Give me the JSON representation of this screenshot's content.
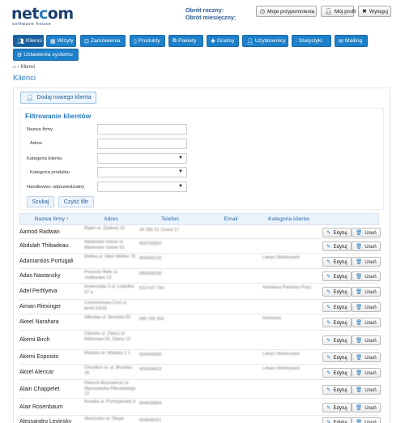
{
  "logo": {
    "main": "net⭕m",
    "main_text": "netcom",
    "tagline": "software house"
  },
  "stats": {
    "annual": "Obrót roczny:",
    "monthly": "Obrót miesięczny:"
  },
  "top_buttons": [
    {
      "label": "Moje przypomnienia",
      "icon": "clock-icon"
    },
    {
      "label": "Mój profil",
      "icon": "user-icon"
    },
    {
      "label": "Wyloguj",
      "icon": "close-icon"
    }
  ],
  "nav": [
    {
      "label": "Klienci",
      "icon": "users-icon"
    },
    {
      "label": "Wizyty",
      "icon": "grid-icon"
    },
    {
      "label": "Zamówienia",
      "icon": "cart-icon"
    },
    {
      "label": "Produkty",
      "icon": "file-icon"
    },
    {
      "label": "Pakiety",
      "icon": "copy-icon"
    },
    {
      "label": "Gratisy",
      "icon": "gift-icon"
    },
    {
      "label": "Użytkownicy",
      "icon": "user-icon"
    },
    {
      "label": "Statystyki",
      "icon": "chart-icon"
    },
    {
      "label": "Mailing",
      "icon": "mail-icon"
    },
    {
      "label": "Ustawienia systemu",
      "icon": "gear-icon"
    }
  ],
  "breadcrumb": {
    "home_icon": "home-icon",
    "separator": "›",
    "current": "Klienci"
  },
  "page_title": "Klienci",
  "add_button": "Dodaj nowego klienta",
  "filter": {
    "title": "Filtrowanie klientów",
    "labels": {
      "company": "Nazwa firmy",
      "address": "Adres",
      "client_category": "Kategoria klienta",
      "product_category": "Kategoria produktu",
      "sales_rep": "Handlowiec odpowiedzialny"
    },
    "search_button": "Szukaj",
    "clear_button": "Czyść filtr"
  },
  "table": {
    "headers": [
      "Nazwa firmy ↑",
      "Adres",
      "Telefon",
      "Email",
      "Kategoria klienta"
    ],
    "edit_label": "Edytuj",
    "delete_label": "Usuń",
    "rows": [
      {
        "name": "Aamod Radwan",
        "addr": "Rypin ul. Zjodnoś 22",
        "phone": "24 390 01 11sew 17",
        "cat": ""
      },
      {
        "name": "Abdulah Thibadeau",
        "addr": "Warlinskie Górne ul. Warlinskie Górne 51",
        "phone": "603755802",
        "cat": ""
      },
      {
        "name": "Adamantios Portugali",
        "addr": "Wołów ul. Wieś Wołów 78",
        "phone": "609556132",
        "cat": "Lekarz Weterynarii"
      },
      {
        "name": "Adas Nastansky",
        "addr": "Pożarów Mały ul. Jodłowska 13",
        "phone": "696506030",
        "cat": ""
      },
      {
        "name": "Adel Perfilyeva",
        "addr": "Inowrocław 3 ul. Łokietka 27 a",
        "phone": "523 547 750",
        "cat": "Hodowca Pokarmu Pasz"
      },
      {
        "name": "Aiman Riexinger",
        "addr": "Częstochowa Cem ul. Armii 54/18",
        "phone": "",
        "cat": ""
      },
      {
        "name": "Akeel Narahara",
        "addr": "Włocław ul. Brońska 82",
        "phone": "690 700 354",
        "cat": "Hodowca"
      },
      {
        "name": "Akemi Birch",
        "addr": "Żdanów ul. Żdany ul. Wiśniowa 20, Żdany 12",
        "phone": "",
        "cat": ""
      },
      {
        "name": "Akemi Esposito",
        "addr": "Kłodzko ul. Wiejska 1 1",
        "phone": "600465830",
        "cat": "Lekarz Weterynarii"
      },
      {
        "name": "Aksel Alencar",
        "addr": "Chrzelice ul. ul. Brzeska 78",
        "phone": "609504912",
        "cat": "Lekarz Weterynarii"
      },
      {
        "name": "Alain Chappelet",
        "addr": "Otwock Mazowiecki ul. Warszawska Piłsudskiego 12",
        "phone": "",
        "cat": ""
      },
      {
        "name": "Alair Rosenbaum",
        "addr": "Kowala ul. Purmyjanska 3",
        "phone": "664426804",
        "cat": ""
      },
      {
        "name": "Alessandro Levinsky",
        "addr": "Skarżysko ul. Długa",
        "phone": "604566311",
        "cat": ""
      }
    ]
  },
  "colors": {
    "accent": "#1e80c8",
    "title": "#2a7bc0",
    "logo": "#1b3f6e"
  }
}
